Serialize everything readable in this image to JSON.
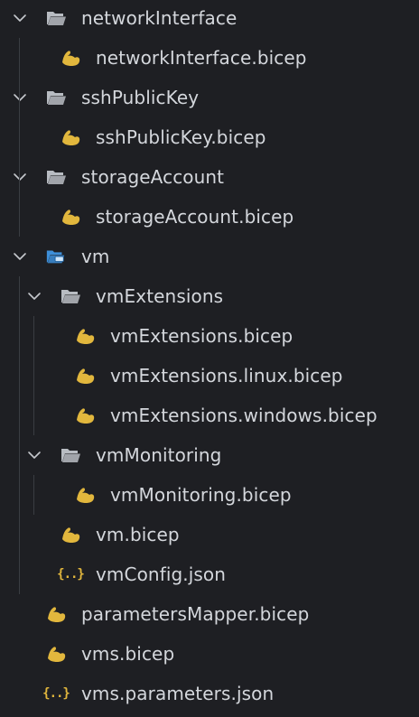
{
  "explorer": {
    "items": [
      {
        "label": "networkInterface",
        "type": "folder",
        "expanded": true,
        "level": 0
      },
      {
        "label": "networkInterface.bicep",
        "type": "bicep",
        "level": 1
      },
      {
        "label": "sshPublicKey",
        "type": "folder",
        "expanded": true,
        "level": 0
      },
      {
        "label": "sshPublicKey.bicep",
        "type": "bicep",
        "level": 1
      },
      {
        "label": "storageAccount",
        "type": "folder",
        "expanded": true,
        "level": 0
      },
      {
        "label": "storageAccount.bicep",
        "type": "bicep",
        "level": 1
      },
      {
        "label": "vm",
        "type": "folder-vm",
        "expanded": true,
        "level": 0
      },
      {
        "label": "vmExtensions",
        "type": "folder",
        "expanded": true,
        "level": 1
      },
      {
        "label": "vmExtensions.bicep",
        "type": "bicep",
        "level": 2
      },
      {
        "label": "vmExtensions.linux.bicep",
        "type": "bicep",
        "level": 2
      },
      {
        "label": "vmExtensions.windows.bicep",
        "type": "bicep",
        "level": 2
      },
      {
        "label": "vmMonitoring",
        "type": "folder",
        "expanded": true,
        "level": 1
      },
      {
        "label": "vmMonitoring.bicep",
        "type": "bicep",
        "level": 2
      },
      {
        "label": "vm.bicep",
        "type": "bicep",
        "level": 1
      },
      {
        "label": "vmConfig.json",
        "type": "json",
        "level": 1
      },
      {
        "label": "parametersMapper.bicep",
        "type": "bicep",
        "level": 0
      },
      {
        "label": "vms.bicep",
        "type": "bicep",
        "level": 0
      },
      {
        "label": "vms.parameters.json",
        "type": "json",
        "level": 0
      }
    ]
  },
  "colors": {
    "background": "#1e1f23",
    "text": "#d4d7dc",
    "folder": "#b8bcc2",
    "vm_folder": "#3d8fd9",
    "bicep": "#e2b73d",
    "json": "#e2b73d",
    "guide": "#3a3d42"
  },
  "icons": {
    "folder": "folder-open-icon",
    "folder-vm": "vm-folder-icon",
    "bicep": "bicep-arm-icon",
    "json": "json-braces-icon",
    "expanded": "chevron-down-icon"
  }
}
